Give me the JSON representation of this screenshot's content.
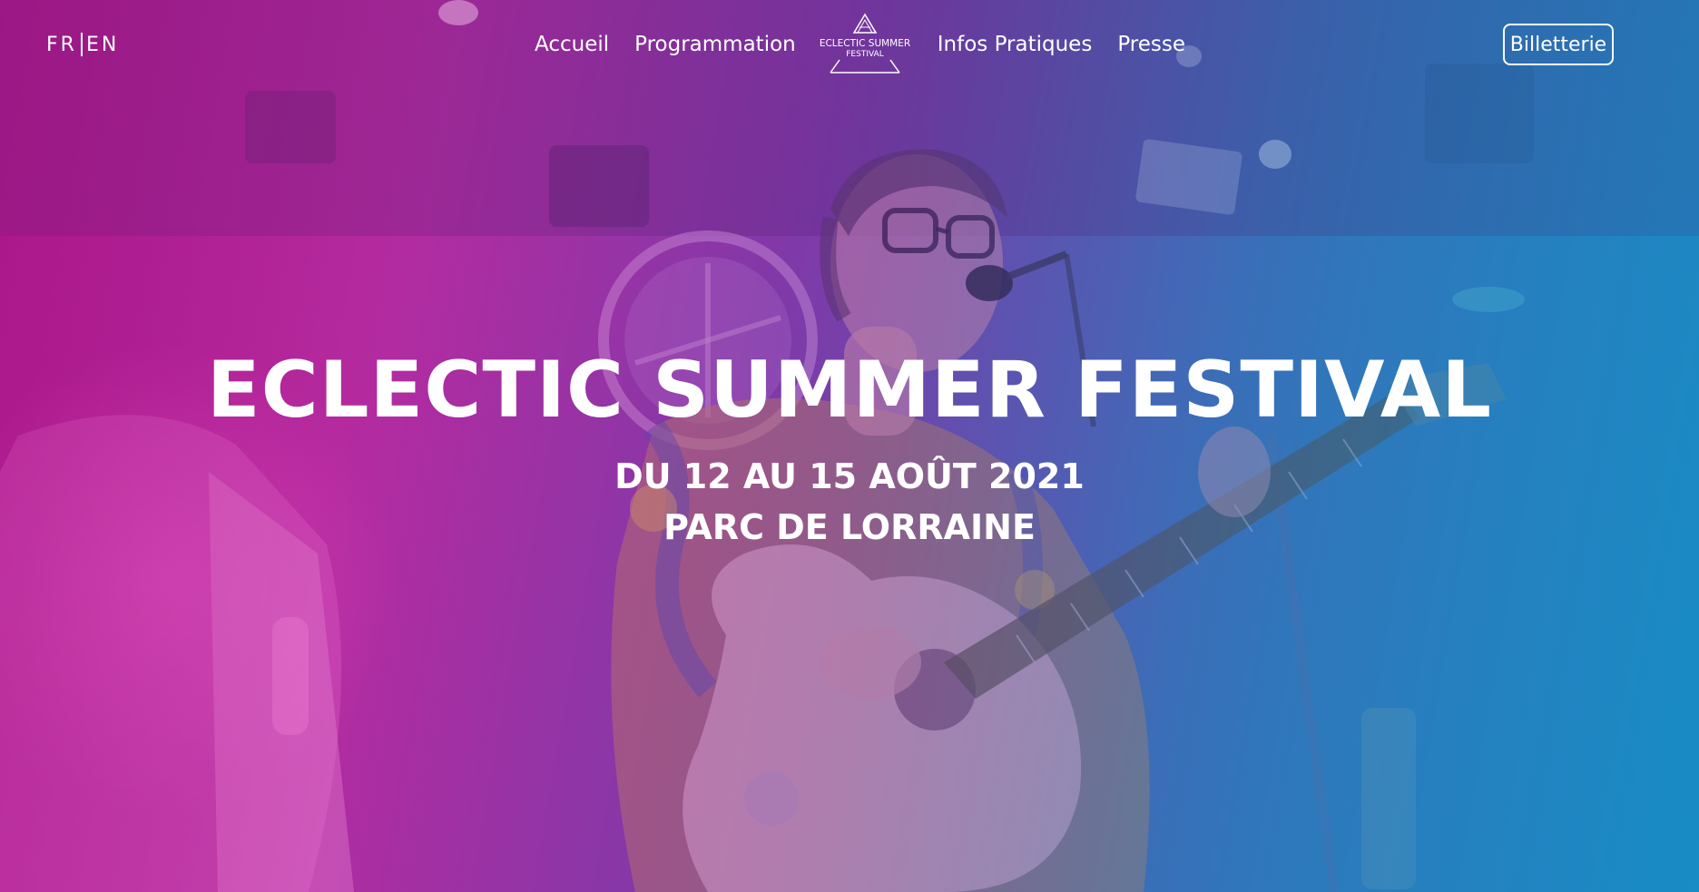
{
  "header": {
    "lang_fr": "FR",
    "lang_en": "EN",
    "nav": {
      "home": "Accueil",
      "program": "Programmation",
      "info": "Infos Pratiques",
      "press": "Presse"
    },
    "logo": {
      "line1": "ECLECTIC SUMMER",
      "line2": "FESTIVAL"
    },
    "ticket_label": "Billetterie"
  },
  "hero": {
    "title": "ECLECTIC SUMMER FESTIVAL",
    "dates": "DU 12 AU 15 AOÛT 2021",
    "place": "PARC DE LORRAINE"
  },
  "colors": {
    "gradient_left": "#a51a86",
    "gradient_mid": "#7d3aa8",
    "gradient_right": "#1e8cc0",
    "text": "#ffffff"
  }
}
